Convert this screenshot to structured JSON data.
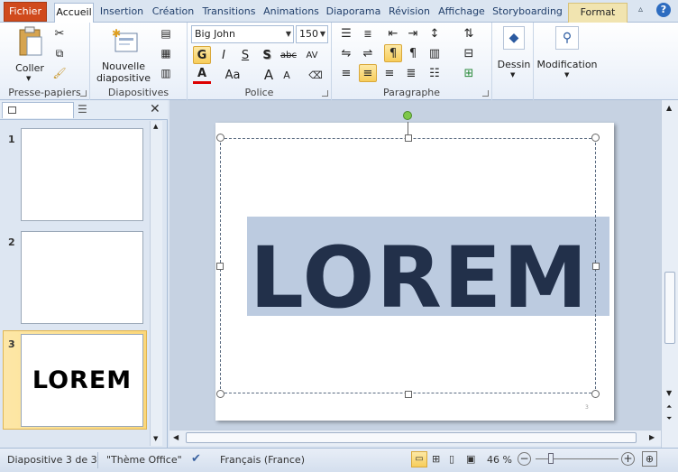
{
  "tabs": {
    "file": "Fichier",
    "home": "Accueil",
    "insert": "Insertion",
    "design": "Création",
    "transitions": "Transitions",
    "animations": "Animations",
    "slideshow": "Diaporama",
    "review": "Révision",
    "view": "Affichage",
    "storyboarding": "Storyboarding",
    "format": "Format"
  },
  "clipboard": {
    "paste_label": "Coller",
    "group_label": "Presse-papiers"
  },
  "slides_group": {
    "new_slide_line1": "Nouvelle",
    "new_slide_line2": "diapositive",
    "group_label": "Diapositives"
  },
  "font": {
    "name": "Big John",
    "size": "150",
    "bold": "G",
    "italic": "I",
    "underline": "S",
    "shadow": "S",
    "strike": "abc",
    "spacing": "AV",
    "color": "A",
    "case": "Aa",
    "grow": "A",
    "shrink": "A",
    "group_label": "Police"
  },
  "paragraph": {
    "group_label": "Paragraphe"
  },
  "drawing": {
    "label": "Dessin"
  },
  "editing": {
    "label": "Modification"
  },
  "slides": [
    {
      "num": "1"
    },
    {
      "num": "2"
    },
    {
      "num": "3",
      "text": "LOREM"
    }
  ],
  "slide": {
    "text": "LOREM",
    "page_number": "3"
  },
  "status": {
    "slide_info": "Diapositive 3 de 3",
    "theme": "\"Thème Office\"",
    "language": "Français (France)",
    "zoom": "46 %"
  },
  "colors": {
    "text": "#22304a",
    "highlight": "#bccbe0",
    "file_tab": "#d04a1c"
  }
}
